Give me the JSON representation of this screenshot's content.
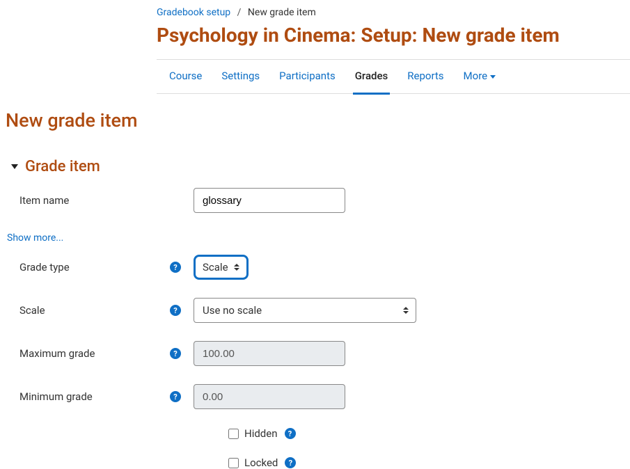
{
  "breadcrumb": {
    "parent": "Gradebook setup",
    "current": "New grade item"
  },
  "page_title": "Psychology in Cinema: Setup: New grade item",
  "tabs": {
    "items": [
      {
        "label": "Course",
        "active": false
      },
      {
        "label": "Settings",
        "active": false
      },
      {
        "label": "Participants",
        "active": false
      },
      {
        "label": "Grades",
        "active": true
      },
      {
        "label": "Reports",
        "active": false
      }
    ],
    "more_label": "More"
  },
  "section_heading": "New grade item",
  "group_heading": "Grade item",
  "show_more_label": "Show more...",
  "form": {
    "item_name": {
      "label": "Item name",
      "value": "glossary"
    },
    "grade_type": {
      "label": "Grade type",
      "value": "Scale"
    },
    "scale": {
      "label": "Scale",
      "value": "Use no scale"
    },
    "max_grade": {
      "label": "Maximum grade",
      "value": "100.00"
    },
    "min_grade": {
      "label": "Minimum grade",
      "value": "0.00"
    },
    "hidden": {
      "label": "Hidden",
      "checked": false
    },
    "locked": {
      "label": "Locked",
      "checked": false
    }
  }
}
